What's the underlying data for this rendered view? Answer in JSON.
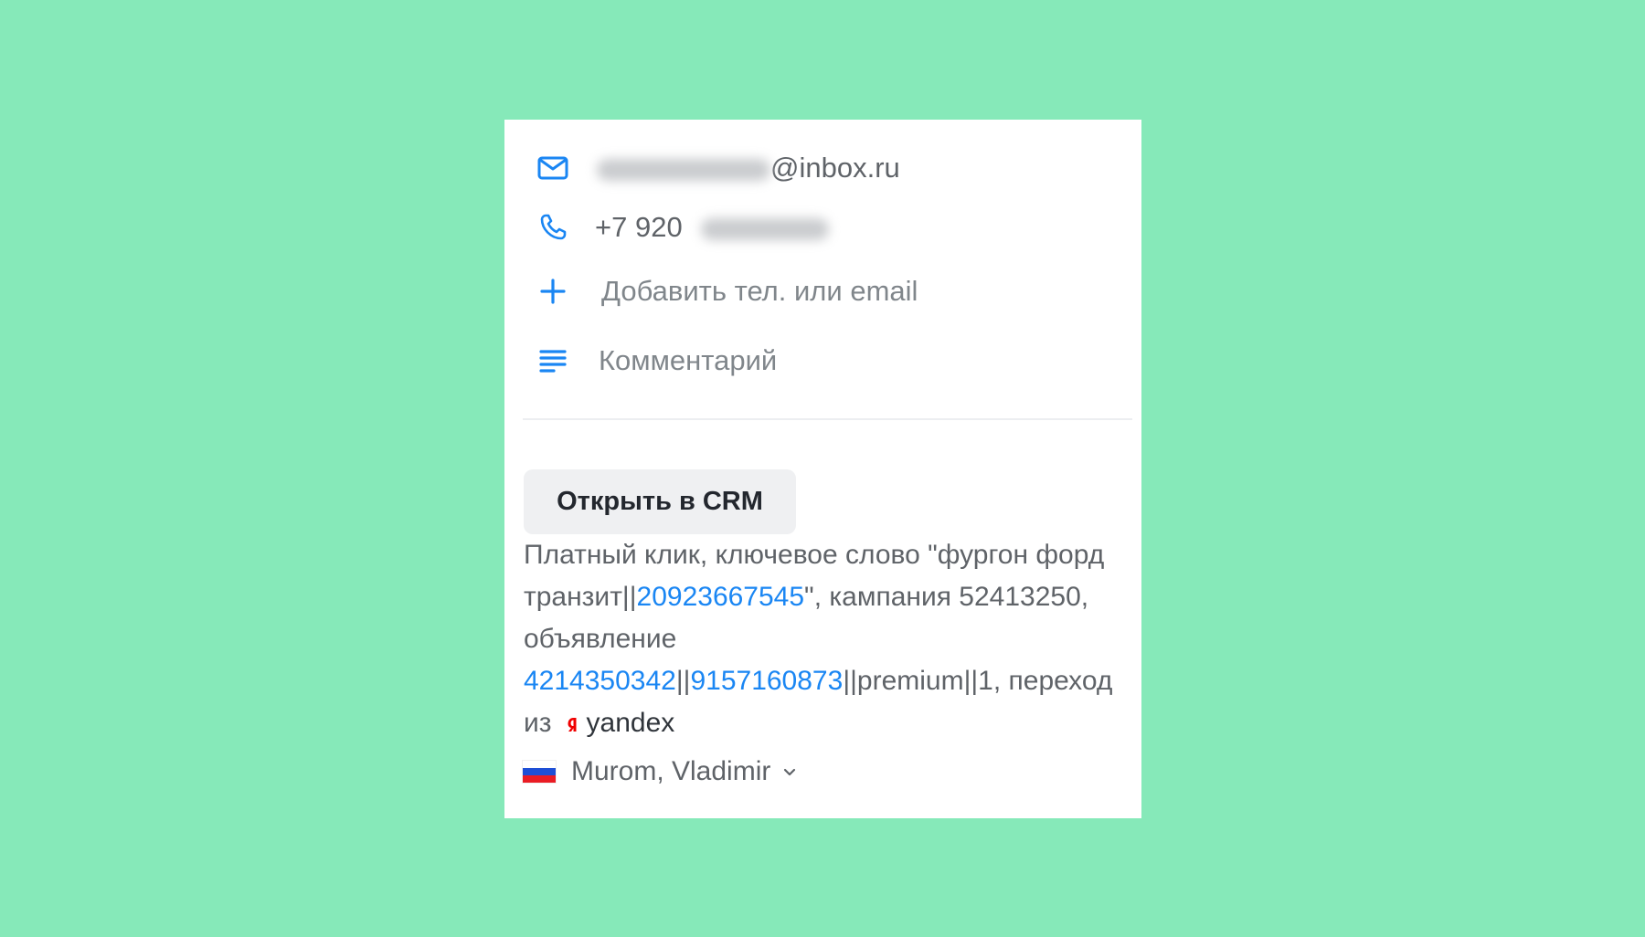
{
  "background_color": "#86e9b9",
  "contact": {
    "email": {
      "icon": "mail-icon",
      "masked_part": "••••••••••",
      "visible_part": "@inbox.ru"
    },
    "phone": {
      "icon": "phone-icon",
      "visible_part": "+7 920",
      "masked_part": "•••••••"
    },
    "add_contact": {
      "icon": "plus-icon",
      "label": "Добавить тел. или email"
    },
    "comment": {
      "icon": "comment-lines-icon",
      "placeholder": "Комментарий"
    }
  },
  "crm_button": {
    "label": "Открыть в CRM"
  },
  "source": {
    "text_1": "Платный клик, ключевое слово \"фургон форд транзит||",
    "link_1": "20923667545",
    "text_2": "\", кампания 52413250, объявление ",
    "link_2": "4214350342",
    "text_3": "||",
    "link_3": "9157160873",
    "text_4": "||premium||1, переход из",
    "engine_icon": "yandex-icon",
    "engine": "yandex"
  },
  "location": {
    "flag": "russia-flag",
    "flag_colors": [
      "#ffffff",
      "#1e4fd6",
      "#ea1c24"
    ],
    "label": "Murom, Vladimir",
    "chevron_icon": "chevron-down-icon"
  },
  "colors": {
    "accent": "#1a86f3",
    "text_muted": "#5f6368",
    "button_bg": "#eff0f2",
    "yandex_red": "#f00000"
  }
}
